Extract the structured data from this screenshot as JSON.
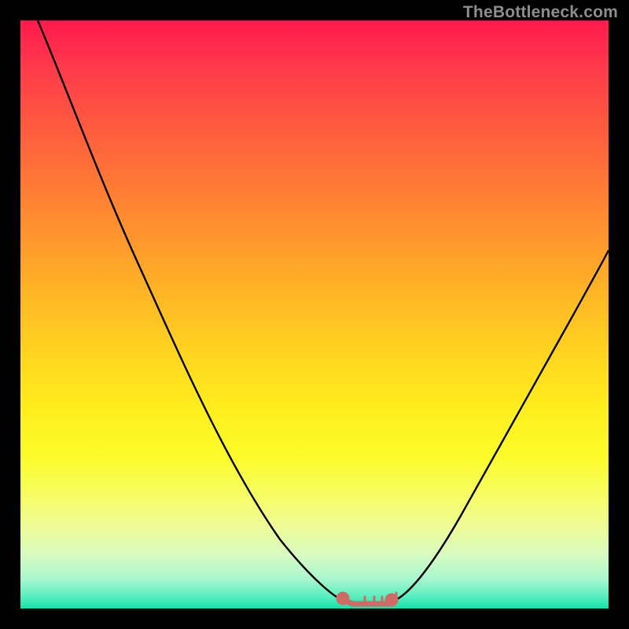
{
  "watermark": "TheBottleneck.com",
  "colors": {
    "curve": "#000000",
    "marker": "#cf6a64",
    "frame": "#000000"
  },
  "chart_data": {
    "type": "line",
    "title": "",
    "xlabel": "",
    "ylabel": "",
    "xlim": [
      0,
      100
    ],
    "ylim": [
      0,
      100
    ],
    "series": [
      {
        "name": "bottleneck-curve",
        "x": [
          3,
          10,
          20,
          30,
          38,
          44,
          50,
          55,
          58,
          60,
          62,
          68,
          72,
          78,
          84,
          90,
          96,
          100
        ],
        "y": [
          100,
          84,
          62,
          42,
          26,
          15,
          6,
          1,
          0,
          0,
          0,
          1,
          5,
          14,
          26,
          39,
          52,
          61
        ]
      }
    ],
    "annotations": [
      {
        "name": "optimal-flat-region",
        "x_range": [
          55,
          63
        ],
        "y": 0
      }
    ]
  }
}
